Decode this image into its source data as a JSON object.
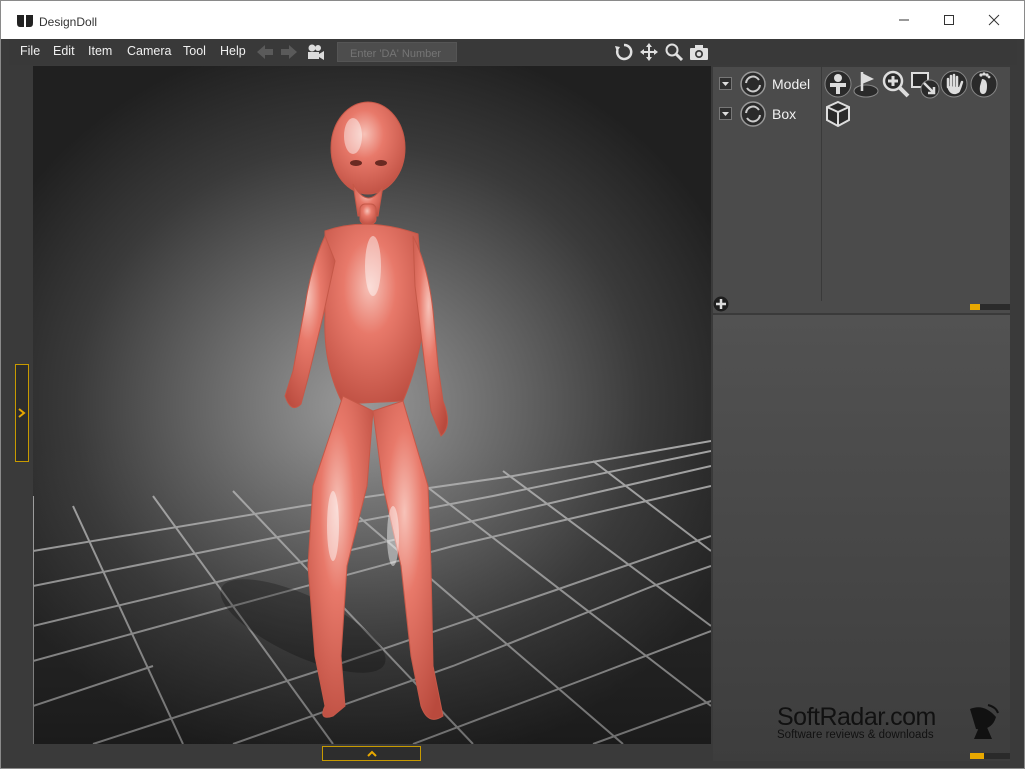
{
  "window": {
    "title": "DesignDoll",
    "controls": [
      "minimize-icon",
      "maximize-icon",
      "close-icon"
    ]
  },
  "menu": {
    "items": [
      "File",
      "Edit",
      "Item",
      "Camera",
      "Tool",
      "Help"
    ]
  },
  "toolbar": {
    "da_placeholder": "Enter 'DA' Number",
    "left_icons": [
      "back-arrow-icon",
      "forward-arrow-icon",
      "camera-icon"
    ],
    "view_icons": [
      "rotate-icon",
      "move-icon",
      "zoom-icon",
      "snapshot-icon"
    ]
  },
  "scene_tree": {
    "items": [
      {
        "label": "Model",
        "icon": "model-icon"
      },
      {
        "label": "Box",
        "icon": "box-icon"
      }
    ],
    "add_icon": "add-icon"
  },
  "tool_palette": {
    "icons": [
      "pose-icon",
      "flag-icon",
      "zoom-plus-icon",
      "scale-icon",
      "hand-icon",
      "foot-icon",
      "cube-icon"
    ]
  },
  "progress": {
    "top_level": 0.25,
    "bottom_level": 0.35
  },
  "watermark": {
    "title": "SoftRadar.com",
    "subtitle": "Software reviews & downloads"
  },
  "colors": {
    "accent": "#e8a800",
    "background": "#3a3a3a",
    "doll": "#e06a5a"
  }
}
